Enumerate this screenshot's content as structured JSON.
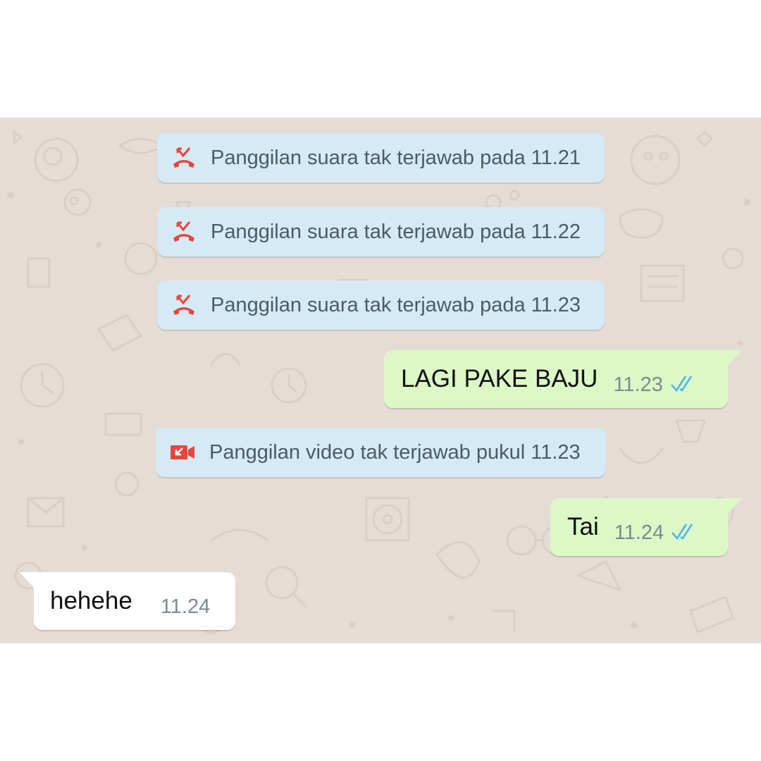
{
  "colors": {
    "chat_background": "#e5ddd5",
    "system_bubble": "#d5eaf5",
    "outgoing_bubble": "#dcf8c6",
    "incoming_bubble": "#ffffff",
    "missed_call_red": "#e8453c",
    "read_ticks_blue": "#4fb6ec"
  },
  "messages": [
    {
      "type": "system",
      "icon": "missed-voice-call-icon",
      "text": "Panggilan suara tak terjawab pada 11.21"
    },
    {
      "type": "system",
      "icon": "missed-voice-call-icon",
      "text": "Panggilan suara tak terjawab pada 11.22"
    },
    {
      "type": "system",
      "icon": "missed-voice-call-icon",
      "text": "Panggilan suara tak terjawab pada 11.23"
    },
    {
      "type": "outgoing",
      "text": "LAGI PAKE BAJU",
      "time": "11.23",
      "status": "read"
    },
    {
      "type": "system",
      "icon": "missed-video-call-icon",
      "text": "Panggilan video tak terjawab pukul 11.23"
    },
    {
      "type": "outgoing",
      "text": "Tai",
      "time": "11.24",
      "status": "read"
    },
    {
      "type": "incoming",
      "text": "hehehe",
      "time": "11.24"
    }
  ]
}
